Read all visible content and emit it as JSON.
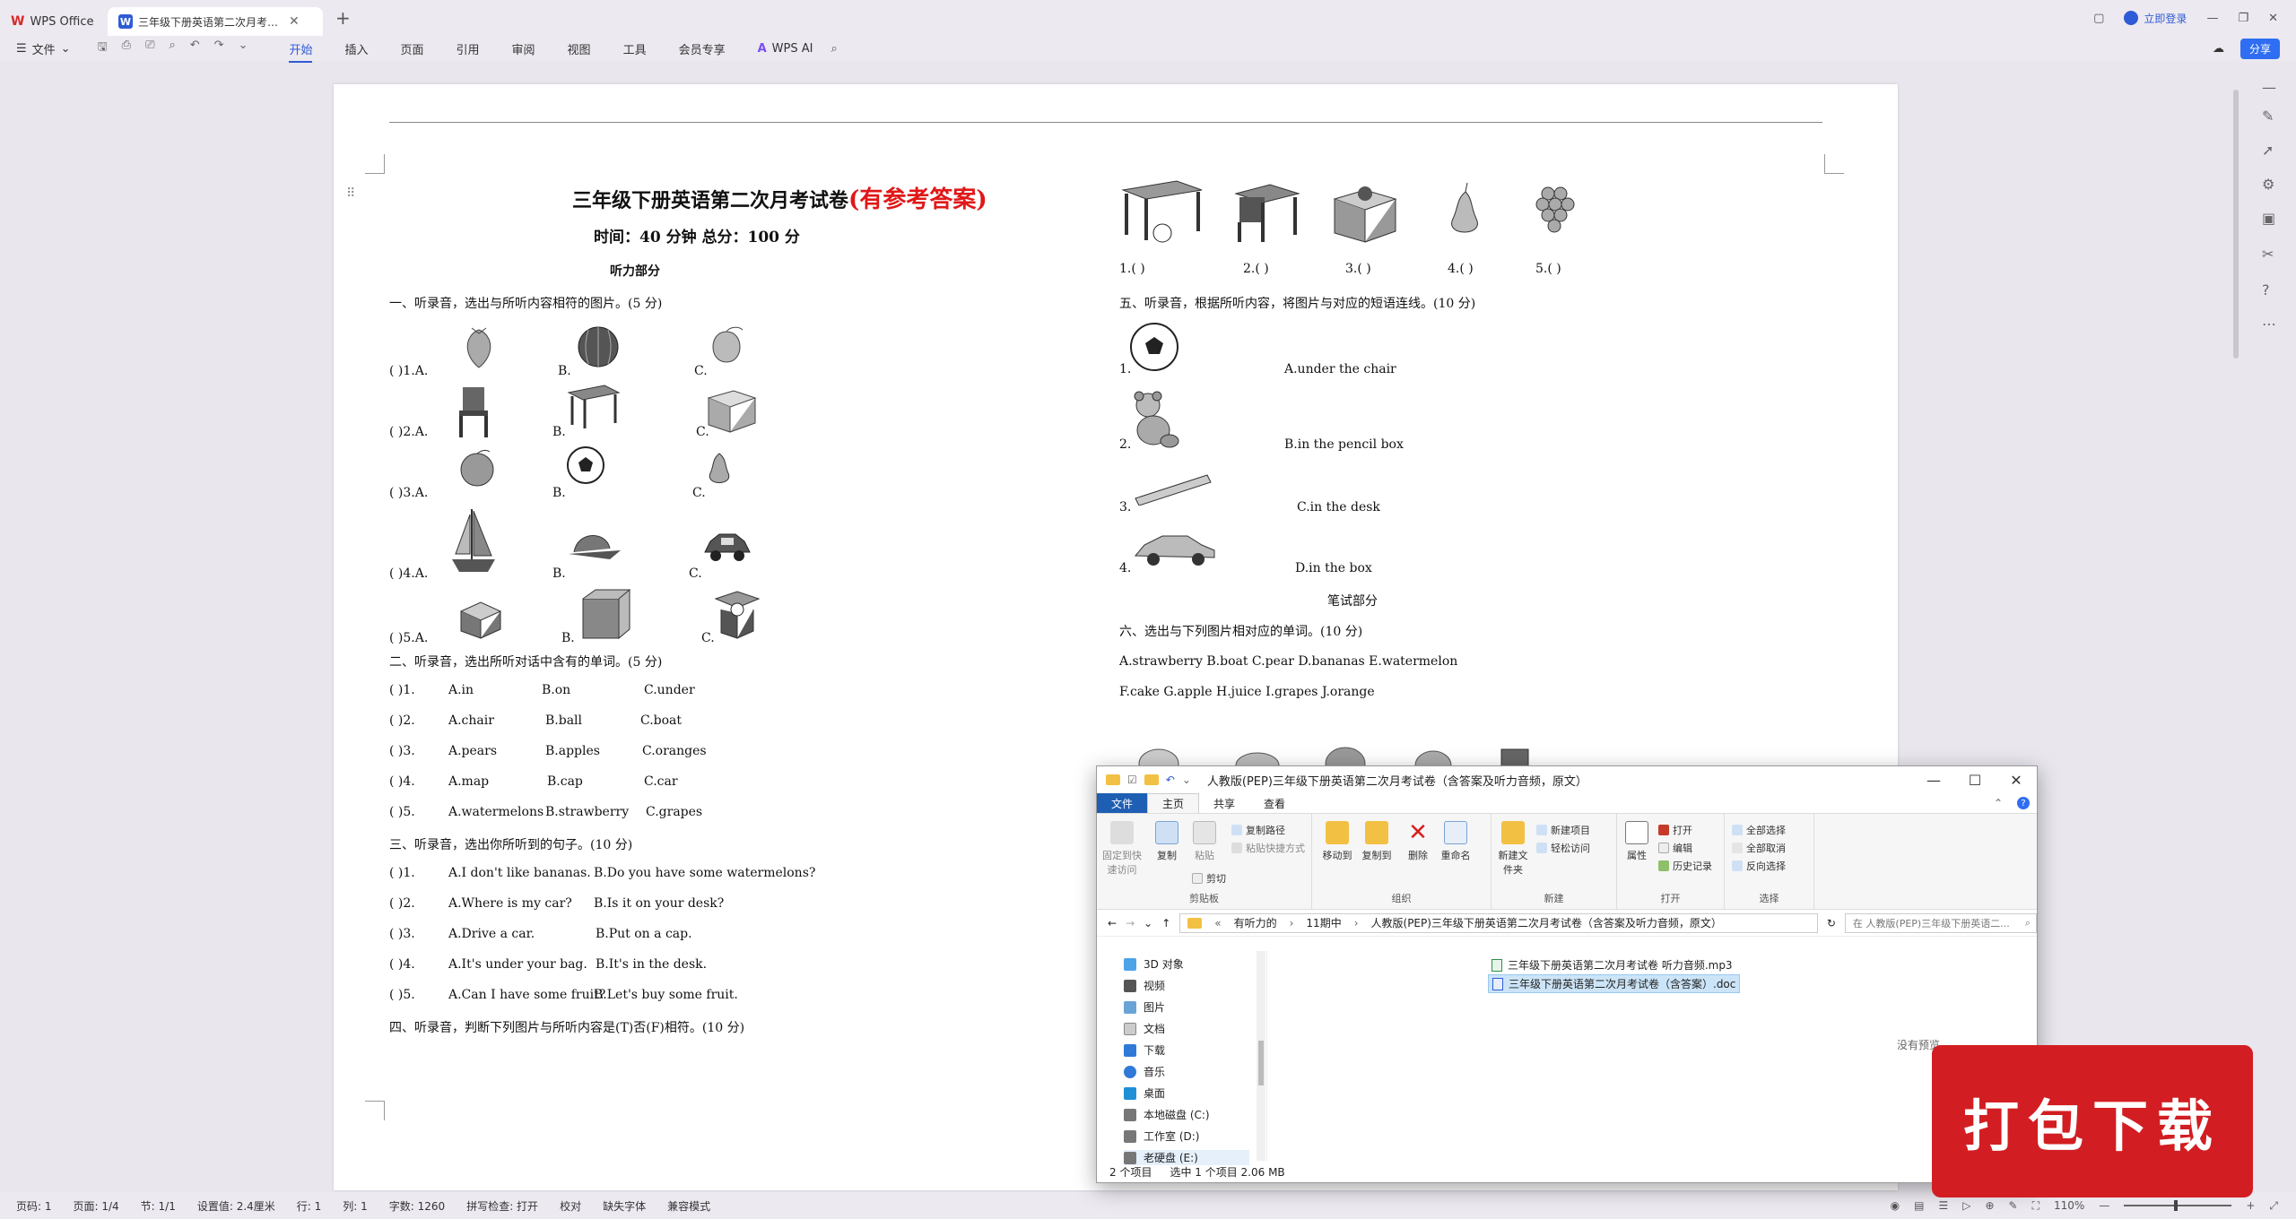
{
  "titlebar": {
    "app_tab": "WPS Office",
    "doc_tab": "三年级下册英语第二次月考试卷",
    "login": "立即登录"
  },
  "ribbon": {
    "file_menu": "文件",
    "menus": [
      "开始",
      "插入",
      "页面",
      "引用",
      "审阅",
      "视图",
      "工具",
      "会员专享"
    ],
    "ai": "WPS AI",
    "share": "分享"
  },
  "doc": {
    "title": "三年级下册英语第二次月考试卷",
    "title_red": "(有参考答案)",
    "time_line": "时间：40 分钟    总分：100 分",
    "listening_header": "听力部分",
    "s1_heading": "一、听录音，选出与所听内容相符的图片。(5 分)",
    "s1_rows": [
      {
        "num": "(        )1.A.",
        "b": "B.",
        "c": "C."
      },
      {
        "num": "(        )2.A.",
        "b": "B.",
        "c": "C."
      },
      {
        "num": "(        )3.A.",
        "b": "B.",
        "c": "C."
      },
      {
        "num": "(        )4.A.",
        "b": "B.",
        "c": "C."
      },
      {
        "num": "(        )5.A.",
        "b": "B.",
        "c": "C."
      }
    ],
    "s2_heading": "二、听录音，选出所听对话中含有的单词。(5 分)",
    "s2_rows": [
      {
        "num": "(        )1.",
        "a": "A.in",
        "b": "B.on",
        "c": "C.under"
      },
      {
        "num": "(        )2.",
        "a": "A.chair",
        "b": "B.ball",
        "c": "C.boat"
      },
      {
        "num": "(        )3.",
        "a": "A.pears",
        "b": "B.apples",
        "c": "C.oranges"
      },
      {
        "num": "(        )4.",
        "a": "A.map",
        "b": "B.cap",
        "c": "C.car"
      },
      {
        "num": "(        )5.",
        "a": "A.watermelons",
        "b": "B.strawberry",
        "c": "C.grapes"
      }
    ],
    "s3_heading": "三、听录音，选出你所听到的句子。(10 分)",
    "s3_rows": [
      {
        "num": "(        )1.",
        "a": "A.I don't like bananas.",
        "b": "B.Do you have some watermelons?"
      },
      {
        "num": "(        )2.",
        "a": "A.Where is my car?",
        "b": "B.Is it on your desk?"
      },
      {
        "num": "(        )3.",
        "a": "A.Drive a car.",
        "b": "B.Put on a cap."
      },
      {
        "num": "(        )4.",
        "a": "A.It's under your bag.",
        "b": "B.It's in the desk."
      },
      {
        "num": "(        )5.",
        "a": "A.Can I have some fruit?",
        "b": "B.Let's buy some fruit."
      }
    ],
    "s4_heading": "四、听录音，判断下列图片与所听内容是(T)否(F)相符。(10 分)",
    "s4_answers": [
      "1.(        )",
      "2.(        )",
      "3.(        )",
      "4.(        )",
      "5.(        )"
    ],
    "s5_heading": "五、听录音，根据所听内容，将图片与对应的短语连线。(10 分)",
    "s5_nums": [
      "1.",
      "2.",
      "3.",
      "4."
    ],
    "s5_phrases": [
      "A.under the chair",
      "B.in the pencil box",
      "C.in the desk",
      "D.in the box"
    ],
    "written_header": "笔试部分",
    "s6_heading": "六、选出与下列图片相对应的单词。(10 分)",
    "s6_words_1": "A.strawberry     B.boat      C.pear     D.bananas    E.watermelon",
    "s6_words_2": "F.cake       G.apple         H.juice          I.grapes            J.orange"
  },
  "statusbar": {
    "page_code": "页码: 1",
    "pages": "页面: 1/4",
    "section": "节: 1/1",
    "setting": "设置值: 2.4厘米",
    "row": "行: 1",
    "col": "列: 1",
    "words": "字数: 1260",
    "spell": "拼写检查: 打开",
    "proof": "校对",
    "missing_font": "缺失字体",
    "compat": "兼容模式",
    "zoom": "110%"
  },
  "explorer": {
    "title": "人教版(PEP)三年级下册英语第二次月考试卷（含答案及听力音频，原文）",
    "tabs": [
      "文件",
      "主页",
      "共享",
      "查看"
    ],
    "groups": {
      "clipboard": "剪贴板",
      "organize": "组织",
      "new": "新建",
      "open": "打开",
      "select": "选择"
    },
    "buttons": {
      "pin": "固定到快速访问",
      "copy": "复制",
      "paste": "粘贴",
      "copy_path": "复制路径",
      "paste_shortcut": "粘贴快捷方式",
      "cut": "剪切",
      "move_to": "移动到",
      "copy_to": "复制到",
      "delete": "删除",
      "rename": "重命名",
      "new_folder": "新建文件夹",
      "new_item": "新建项目",
      "easy_access": "轻松访问",
      "properties": "属性",
      "open": "打开",
      "edit": "编辑",
      "history": "历史记录",
      "select_all": "全部选择",
      "select_none": "全部取消",
      "invert": "反向选择"
    },
    "path": [
      "有听力的",
      "11期中",
      "人教版(PEP)三年级下册英语第二次月考试卷（含答案及听力音频，原文）"
    ],
    "search_placeholder": "在 人教版(PEP)三年级下册英语二...",
    "nav": [
      "3D 对象",
      "视频",
      "图片",
      "文档",
      "下载",
      "音乐",
      "桌面",
      "本地磁盘 (C:)",
      "工作室 (D:)",
      "老硬盘 (E:)"
    ],
    "files": [
      "三年级下册英语第二次月考试卷 听力音频.mp3",
      "三年级下册英语第二次月考试卷（含答案）.doc"
    ],
    "preview": "没有预览。",
    "status_count": "2 个项目",
    "status_selected": "选中 1 个项目  2.06 MB"
  },
  "stamp": "打包下载"
}
